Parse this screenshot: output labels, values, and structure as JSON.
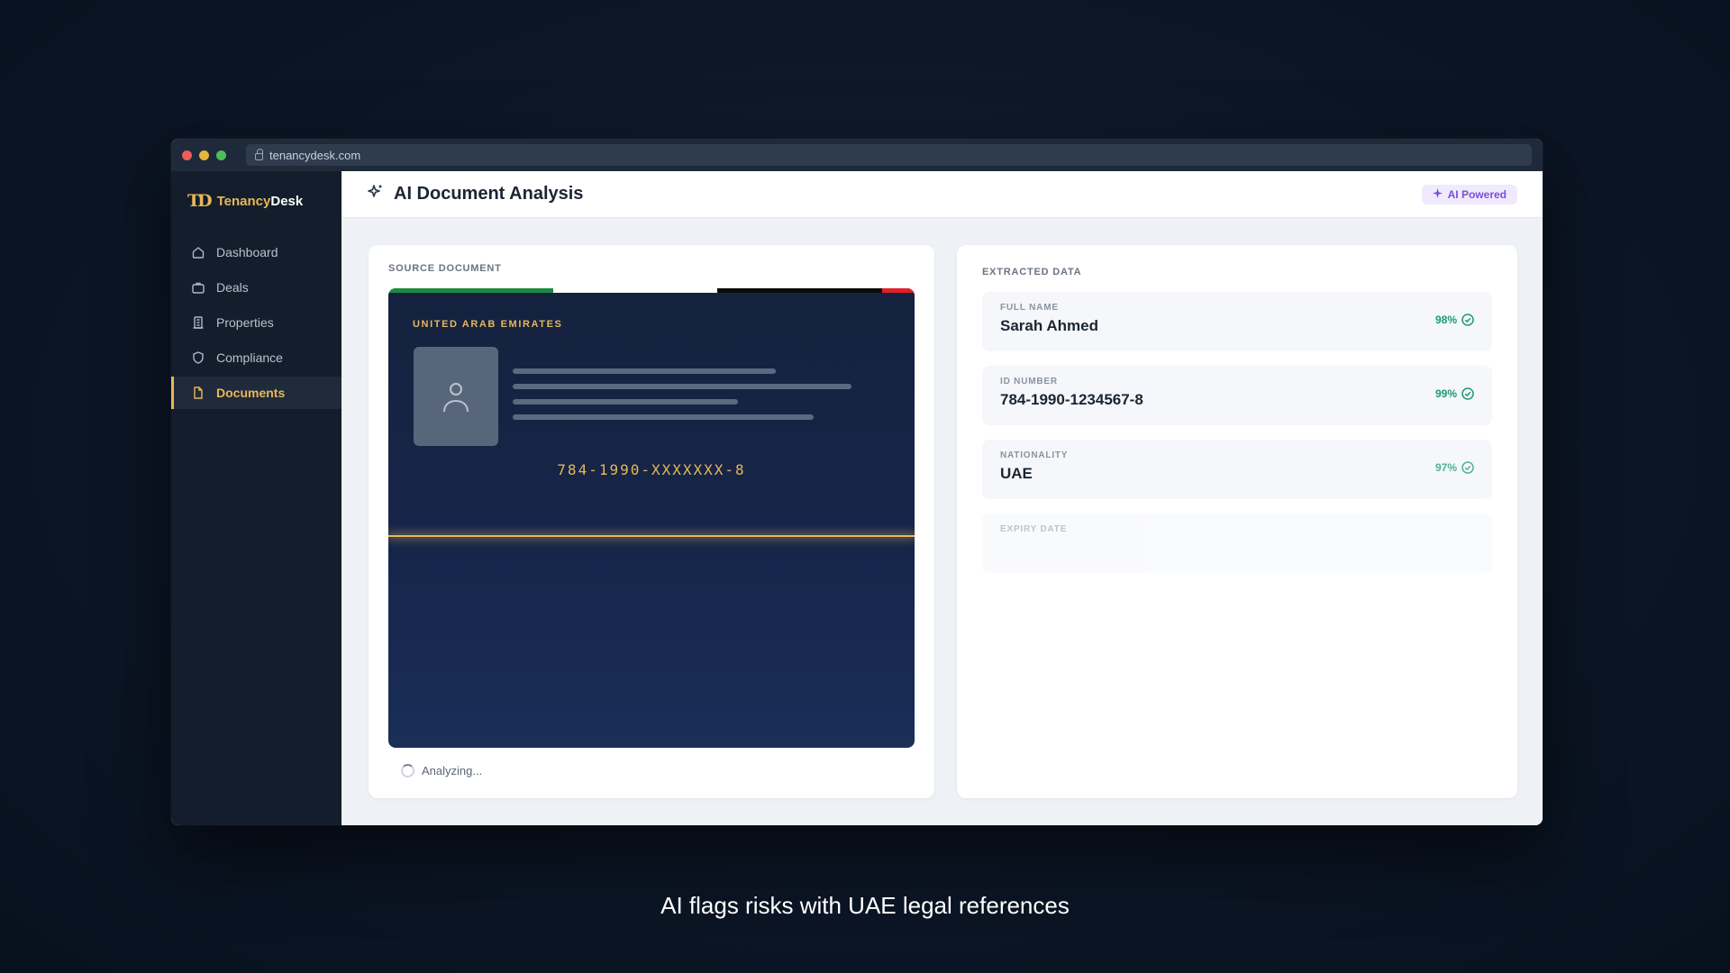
{
  "browser": {
    "url": "tenancydesk.com"
  },
  "brand": {
    "mark": "TD",
    "name_part1": "Tenancy",
    "name_part2": "Desk"
  },
  "sidebar": {
    "items": [
      {
        "label": "Dashboard",
        "icon": "home-icon"
      },
      {
        "label": "Deals",
        "icon": "briefcase-icon"
      },
      {
        "label": "Properties",
        "icon": "building-icon"
      },
      {
        "label": "Compliance",
        "icon": "shield-icon"
      },
      {
        "label": "Documents",
        "icon": "document-icon",
        "active": true
      }
    ]
  },
  "header": {
    "title": "AI Document Analysis",
    "badge": "AI Powered"
  },
  "source": {
    "label": "SOURCE DOCUMENT",
    "card": {
      "country": "UNITED ARAB EMIRATES",
      "id_number": "784-1990-XXXXXXX-8"
    },
    "status": "Analyzing..."
  },
  "extracted": {
    "label": "EXTRACTED DATA",
    "fields": [
      {
        "label": "FULL NAME",
        "value": "Sarah Ahmed",
        "confidence": "98%"
      },
      {
        "label": "ID NUMBER",
        "value": "784-1990-1234567-8",
        "confidence": "99%"
      },
      {
        "label": "NATIONALITY",
        "value": "UAE",
        "confidence": "97%"
      },
      {
        "label": "EXPIRY DATE",
        "value": "",
        "confidence": ""
      }
    ]
  },
  "caption": "AI flags risks with UAE legal references",
  "colors": {
    "accent": "#e7b75a",
    "confidence": "#1d9a6c",
    "ai_badge": "#7c4ddc"
  }
}
